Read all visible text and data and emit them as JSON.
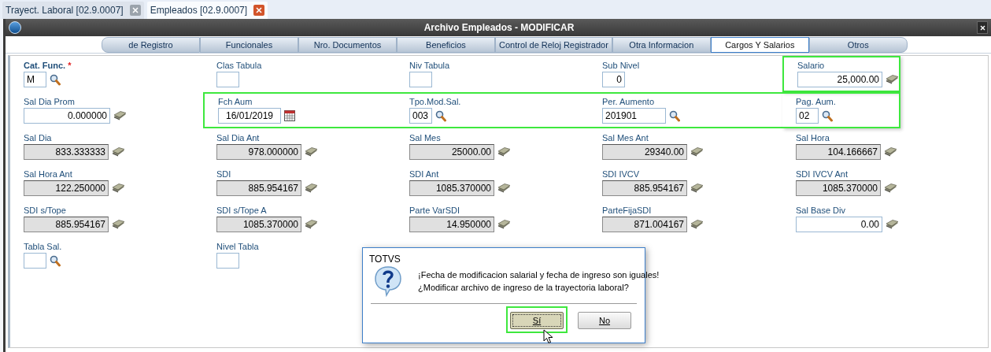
{
  "doc_tabs": [
    {
      "label": "Trayect. Laboral [02.9.0007]",
      "selected": false
    },
    {
      "label": "Empleados [02.9.0007]",
      "selected": true
    }
  ],
  "window": {
    "title": "Archivo Empleados - MODIFICAR"
  },
  "tabs": [
    {
      "label": "de Registro",
      "selected": false
    },
    {
      "label": "Funcionales",
      "selected": false
    },
    {
      "label": "Nro. Documentos",
      "selected": false
    },
    {
      "label": "Beneficios",
      "selected": false
    },
    {
      "label": "Control de Reloj Registrador",
      "selected": false
    },
    {
      "label": "Otra Informacion",
      "selected": false
    },
    {
      "label": "Cargos Y Salarios",
      "selected": true
    },
    {
      "label": "Otros",
      "selected": false
    }
  ],
  "rows": [
    [
      {
        "label": "Cat. Func.",
        "marker": "*",
        "value": "M",
        "kind": "code",
        "highlighted": false
      },
      {
        "label": "Clas Tabula",
        "kind": "box",
        "highlighted": false
      },
      {
        "label": "Niv Tabula",
        "kind": "box",
        "highlighted": false
      },
      {
        "label": "Sub Nivel",
        "value": "0",
        "kind": "number",
        "highlighted": false
      },
      {
        "label": "Salario",
        "value": "25,000.00",
        "kind": "amount",
        "highlighted": true
      }
    ],
    [
      {
        "label": "Sal Dia Prom",
        "value": "0.000000",
        "kind": "amount",
        "highlighted": false
      },
      {
        "label": "Fch Aum",
        "value": "16/01/2019",
        "kind": "date",
        "highlighted": true
      },
      {
        "label": "Tpo.Mod.Sal.",
        "value": "003",
        "kind": "code",
        "highlighted": true
      },
      {
        "label": "Per. Aumento",
        "value": "201901",
        "kind": "period",
        "highlighted": true
      },
      {
        "label": "Pag. Aum.",
        "value": "02",
        "kind": "code",
        "highlighted": true
      }
    ],
    [
      {
        "label": "Sal Dia",
        "value": "833.333333",
        "kind": "total",
        "highlighted": false
      },
      {
        "label": "Sal Dia Ant",
        "value": "978.000000",
        "kind": "total",
        "highlighted": false
      },
      {
        "label": "Sal Mes",
        "value": "25000.00",
        "kind": "total",
        "highlighted": false
      },
      {
        "label": "Sal Mes Ant",
        "value": "29340.00",
        "kind": "total",
        "highlighted": false
      },
      {
        "label": "Sal Hora",
        "value": "104.166667",
        "kind": "total",
        "highlighted": false
      }
    ],
    [
      {
        "label": "Sal Hora Ant",
        "value": "122.250000",
        "kind": "total",
        "highlighted": false
      },
      {
        "label": "SDI",
        "value": "885.954167",
        "kind": "total",
        "highlighted": false
      },
      {
        "label": "SDI Ant",
        "value": "1085.370000",
        "kind": "total",
        "highlighted": false
      },
      {
        "label": "SDI IVCV",
        "value": "885.954167",
        "kind": "total",
        "highlighted": false
      },
      {
        "label": "SDI IVCV Ant",
        "value": "1085.370000",
        "kind": "total",
        "highlighted": false
      }
    ],
    [
      {
        "label": "SDI s/Tope",
        "value": "885.954167",
        "kind": "total",
        "highlighted": false
      },
      {
        "label": "SDI s/Tope A",
        "value": "1085.370000",
        "kind": "total",
        "highlighted": false
      },
      {
        "label": "Parte VarSDI",
        "value": "14.950000",
        "kind": "total",
        "highlighted": false
      },
      {
        "label": "ParteFijaSDI",
        "value": "871.004167",
        "kind": "total",
        "highlighted": false
      },
      {
        "label": "Sal Base Div",
        "value": "0.00",
        "kind": "amount",
        "highlighted": false
      }
    ],
    [
      {
        "label": "Tabla Sal.",
        "kind": "code",
        "highlighted": false
      },
      {
        "label": "Nivel Tabla",
        "kind": "box",
        "highlighted": false
      }
    ]
  ],
  "dialog": {
    "title": "TOTVS",
    "lines": [
      "¡Fecha de modificacion salarial y fecha de ingreso son iguales!",
      "¿Modificar archivo de ingreso de la trayectoria laboral?"
    ],
    "buttons": [
      {
        "label": "Sí",
        "focused": true,
        "highlighted": true
      },
      {
        "label": "No",
        "focused": false,
        "highlighted": false
      }
    ]
  }
}
